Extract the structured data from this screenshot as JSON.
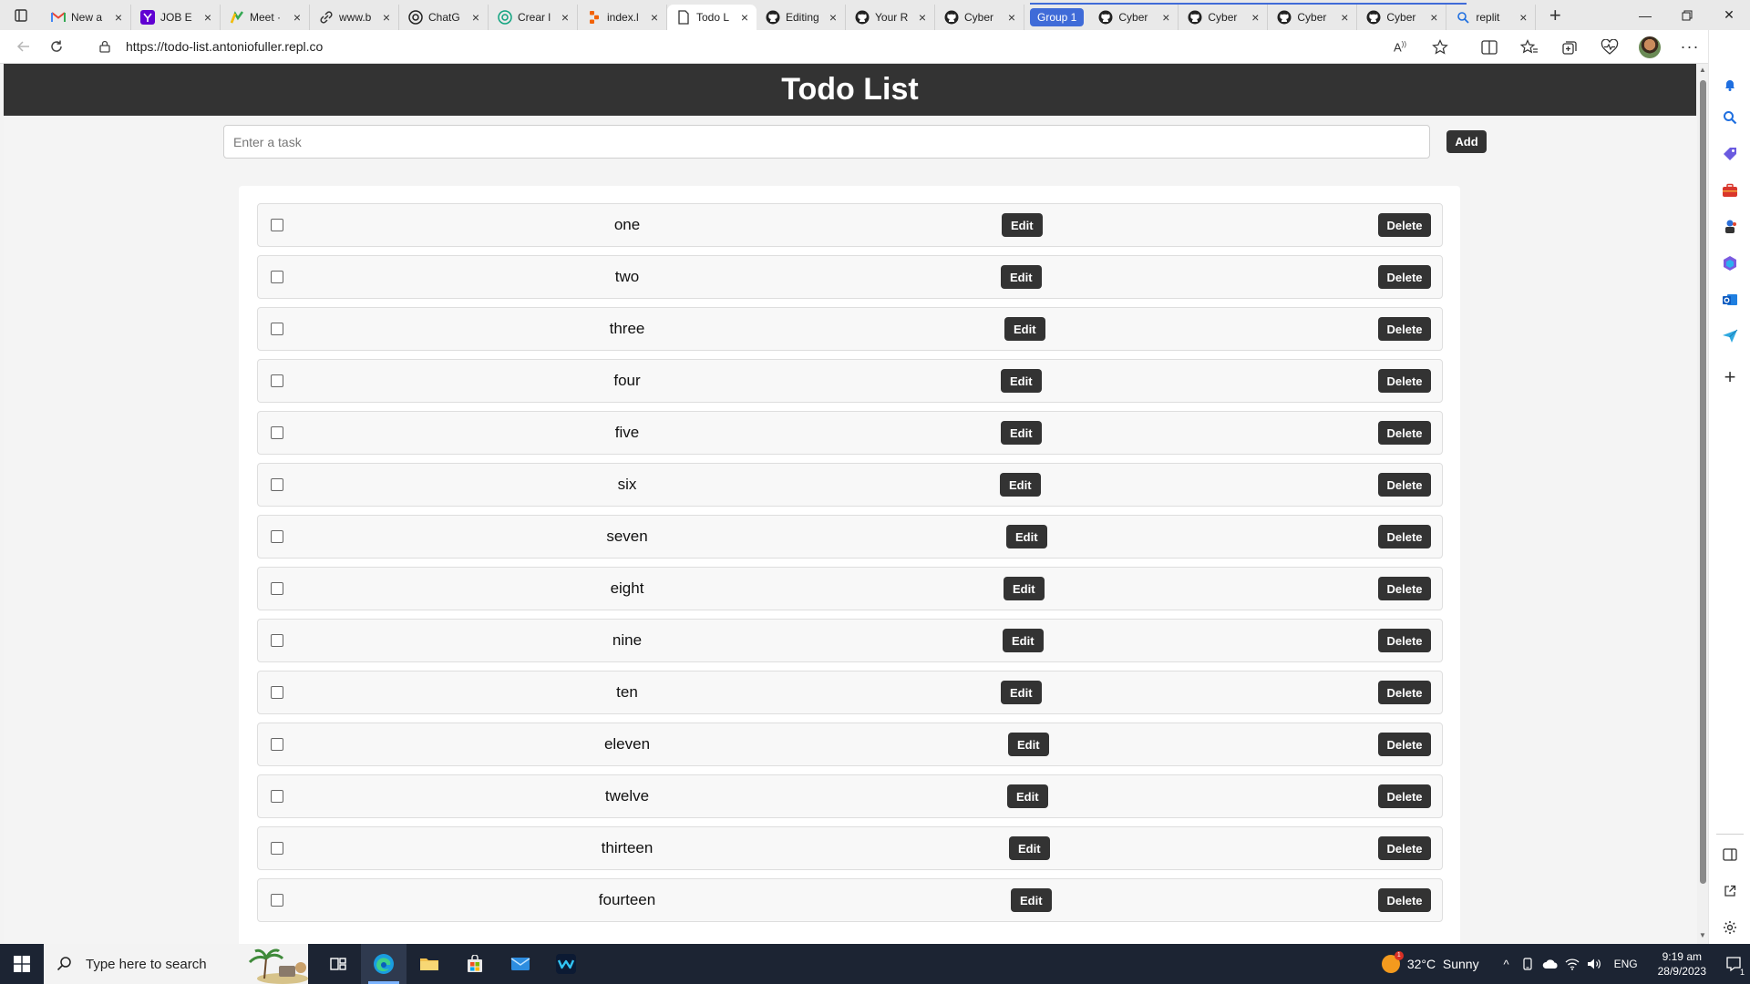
{
  "browser": {
    "tabs": [
      {
        "title": "New a",
        "icon": "gmail-icon"
      },
      {
        "title": "JOB E",
        "icon": "yahoo-icon"
      },
      {
        "title": "Meet ·",
        "icon": "keep-icon"
      },
      {
        "title": "www.b",
        "icon": "link-icon"
      },
      {
        "title": "ChatG",
        "icon": "chatgpt-icon"
      },
      {
        "title": "Crear l",
        "icon": "chatgpt-green-icon"
      },
      {
        "title": "index.l",
        "icon": "replit-icon"
      },
      {
        "title": "Todo L",
        "icon": "page-icon",
        "active": true
      },
      {
        "title": "Editing",
        "icon": "github-icon"
      },
      {
        "title": "Your R",
        "icon": "github-icon"
      },
      {
        "title": "Cyber",
        "icon": "github-icon"
      }
    ],
    "group_label": "Group 1",
    "group_tabs": [
      {
        "title": "Cyber",
        "icon": "github-icon"
      },
      {
        "title": "Cyber",
        "icon": "github-icon"
      },
      {
        "title": "Cyber",
        "icon": "github-icon"
      },
      {
        "title": "Cyber",
        "icon": "github-icon"
      }
    ],
    "last_tab": {
      "title": "replit",
      "icon": "search-icon"
    },
    "url": "https://todo-list.antoniofuller.repl.co",
    "accent": "#3f6bd8"
  },
  "app": {
    "title": "Todo List",
    "input_placeholder": "Enter a task",
    "add_label": "Add",
    "edit_label": "Edit",
    "delete_label": "Delete",
    "tasks": [
      "one",
      "two",
      "three",
      "four",
      "five",
      "six",
      "seven",
      "eight",
      "nine",
      "ten",
      "eleven",
      "twelve",
      "thirteen",
      "fourteen"
    ],
    "header_color": "#333333"
  },
  "taskbar": {
    "search_placeholder": "Type here to search",
    "weather": "32°C  Sunny",
    "weather_badge": "1",
    "lang": "ENG",
    "time": "9:19 am",
    "date": "28/9/2023",
    "notifications": "1"
  }
}
